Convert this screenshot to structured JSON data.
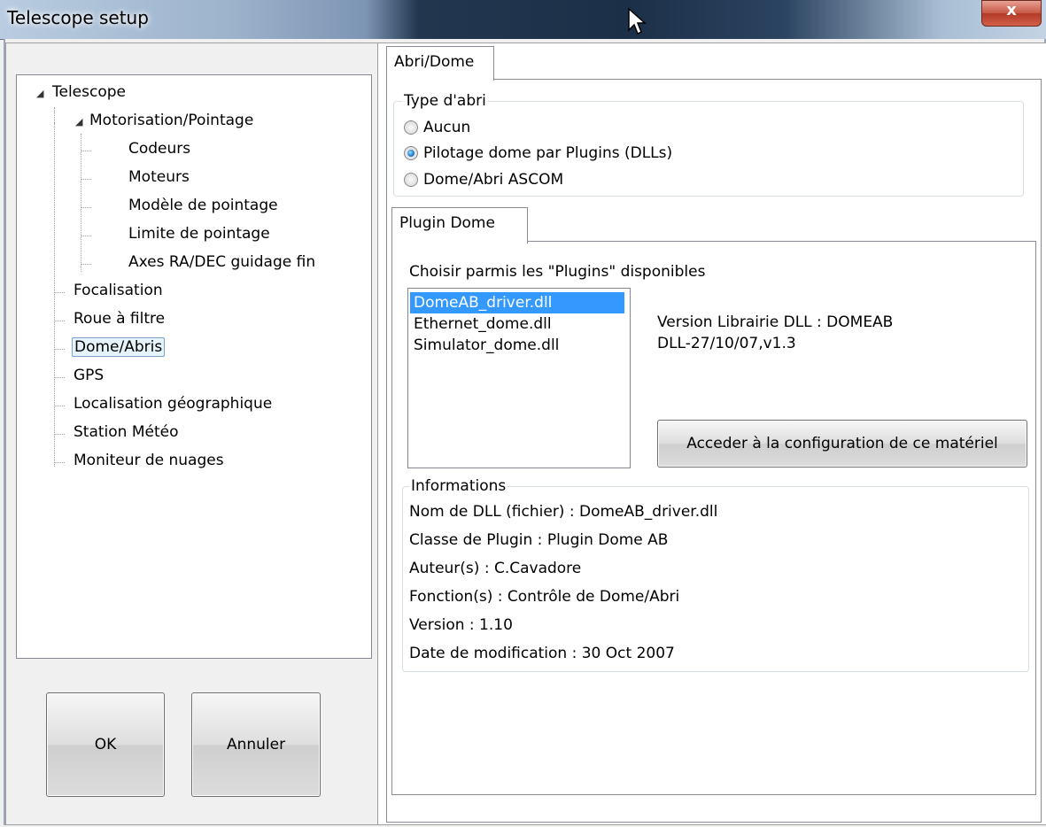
{
  "window": {
    "title": "Telescope setup",
    "close_glyph": "x"
  },
  "tree": {
    "items": [
      {
        "label": "Telescope"
      },
      {
        "label": "Motorisation/Pointage"
      },
      {
        "label": "Codeurs"
      },
      {
        "label": "Moteurs"
      },
      {
        "label": "Modèle de pointage"
      },
      {
        "label": "Limite de pointage"
      },
      {
        "label": "Axes RA/DEC guidage fin"
      },
      {
        "label": "Focalisation"
      },
      {
        "label": "Roue à filtre"
      },
      {
        "label": "Dome/Abris"
      },
      {
        "label": "GPS"
      },
      {
        "label": "Localisation géographique"
      },
      {
        "label": "Station Météo"
      },
      {
        "label": "Moniteur de nuages"
      }
    ],
    "selected": "Dome/Abris"
  },
  "buttons": {
    "ok": "OK",
    "cancel": "Annuler",
    "configure": "Acceder à la configuration de ce matériel"
  },
  "tabs": {
    "main": "Abri/Dome",
    "plugin": "Plugin Dome"
  },
  "shelter_type": {
    "legend": "Type d'abri",
    "options": [
      {
        "label": "Aucun",
        "checked": false
      },
      {
        "label": "Pilotage dome par Plugins (DLLs)",
        "checked": true
      },
      {
        "label": "Dome/Abri ASCOM",
        "checked": false
      }
    ]
  },
  "plugin": {
    "prompt": "Choisir parmis les \"Plugins\" disponibles",
    "list": [
      "DomeAB_driver.dll",
      "Ethernet_dome.dll",
      "Simulator_dome.dll"
    ],
    "selected": "DomeAB_driver.dll",
    "version_line1": "Version Librairie DLL : DOMEAB",
    "version_line2": "DLL-27/10/07,v1.3"
  },
  "informations": {
    "legend": "Informations",
    "lines": [
      "Nom de DLL (fichier) : DomeAB_driver.dll",
      "Classe de Plugin : Plugin Dome AB",
      "Auteur(s) : C.Cavadore",
      "Fonction(s) : Contrôle de Dome/Abri",
      "Version : 1.10",
      "Date de modification : 30 Oct 2007"
    ]
  }
}
